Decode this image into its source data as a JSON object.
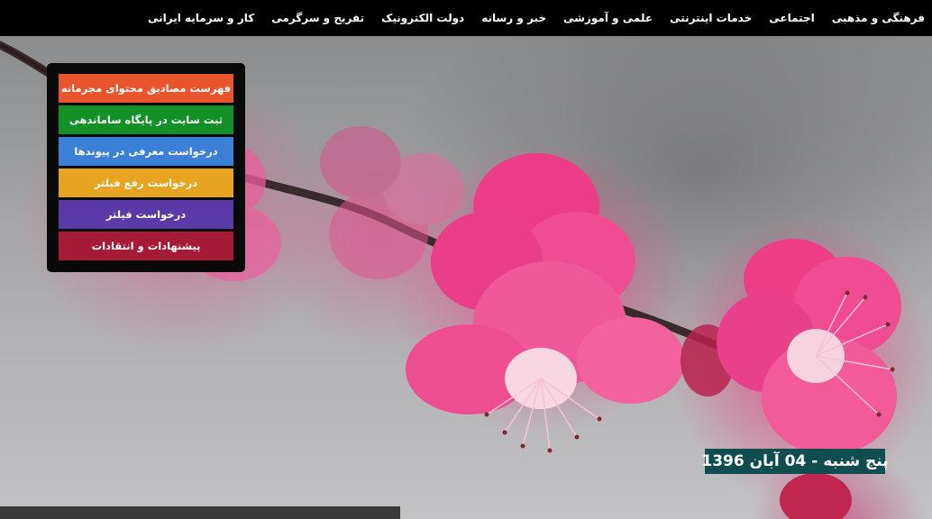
{
  "nav": {
    "items": [
      "فرهنگی و مذهبی",
      "اجتماعی",
      "خدمات اینترنتی",
      "علمی و آموزشی",
      "خبر و رسانه",
      "دولت الکترونیک",
      "تفریح و سرگرمی",
      "کار و سرمایه ایرانی"
    ]
  },
  "side_menu": {
    "items": [
      {
        "label": "فهرست مصادیق محتوای مجرمانه",
        "color": "#e8552c"
      },
      {
        "label": "ثبت سایت در پایگاه ساماندهی",
        "color": "#149126"
      },
      {
        "label": "درخواست معرفی در پیوندها",
        "color": "#3b7fd6"
      },
      {
        "label": "درخواست رفع فیلتر",
        "color": "#e6a420"
      },
      {
        "label": "درخواست فیلتر",
        "color": "#5a3aa6"
      },
      {
        "label": "پیشنهادات و انتقادات",
        "color": "#a51b35"
      }
    ]
  },
  "date": {
    "text": "پنج شنبه - 04 آبان 1396"
  },
  "colors": {
    "topbar": "#000000",
    "date_badge": "#0f4d50",
    "panel": "#0a0a0a"
  }
}
